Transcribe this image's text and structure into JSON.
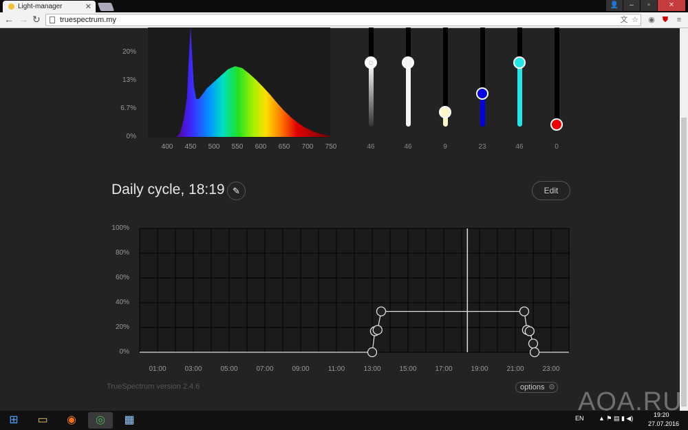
{
  "browser": {
    "tab_title": "Light-manager",
    "url": "truespectrum.my"
  },
  "spectrum": {
    "y_ticks": [
      "0%",
      "6.7%",
      "13%",
      "20%"
    ],
    "x_ticks": [
      "400",
      "450",
      "500",
      "550",
      "600",
      "650",
      "700",
      "750"
    ],
    "points": [
      [
        420,
        0
      ],
      [
        428,
        1
      ],
      [
        435,
        4
      ],
      [
        442,
        9
      ],
      [
        446,
        18
      ],
      [
        450,
        26
      ],
      [
        453,
        20
      ],
      [
        457,
        12
      ],
      [
        462,
        9
      ],
      [
        468,
        9
      ],
      [
        475,
        10
      ],
      [
        485,
        11.5
      ],
      [
        500,
        13
      ],
      [
        515,
        14.5
      ],
      [
        530,
        16
      ],
      [
        545,
        16.7
      ],
      [
        560,
        16.3
      ],
      [
        575,
        15
      ],
      [
        590,
        13.5
      ],
      [
        605,
        11.8
      ],
      [
        620,
        10
      ],
      [
        635,
        8
      ],
      [
        650,
        6.2
      ],
      [
        665,
        4.6
      ],
      [
        680,
        3.3
      ],
      [
        695,
        2.2
      ],
      [
        710,
        1.4
      ],
      [
        725,
        0.8
      ],
      [
        740,
        0.4
      ],
      [
        750,
        0.2
      ]
    ]
  },
  "sliders": [
    {
      "name": "master",
      "value": 46,
      "color": "#ffffff",
      "icon": "sun-icon"
    },
    {
      "name": "white",
      "value": 46,
      "color": "#f4f4f8"
    },
    {
      "name": "warm",
      "value": 9,
      "color": "#fdf7c9"
    },
    {
      "name": "blue",
      "value": 23,
      "color": "#0000e0"
    },
    {
      "name": "cyan",
      "value": 46,
      "color": "#22e6e6"
    },
    {
      "name": "red",
      "value": 0,
      "color": "#ee0000"
    }
  ],
  "cycle": {
    "title": "Daily cycle, 18:19",
    "edit_label": "Edit",
    "current_time": 18.32
  },
  "chart_data": {
    "type": "line",
    "y_ticks": [
      "0%",
      "20%",
      "40%",
      "60%",
      "80%",
      "100%"
    ],
    "x_ticks": [
      "01:00",
      "03:00",
      "05:00",
      "07:00",
      "09:00",
      "11:00",
      "13:00",
      "15:00",
      "17:00",
      "19:00",
      "21:00",
      "23:00"
    ],
    "xlim": [
      0,
      24
    ],
    "ylim": [
      0,
      100
    ],
    "grid": true,
    "points": [
      [
        13.0,
        0
      ],
      [
        13.15,
        17
      ],
      [
        13.3,
        18
      ],
      [
        13.5,
        33
      ],
      [
        21.5,
        33
      ],
      [
        21.65,
        18
      ],
      [
        21.8,
        17
      ],
      [
        22.0,
        7
      ],
      [
        22.08,
        0
      ]
    ]
  },
  "footer": {
    "version": "TrueSpectrum version 2.4.6",
    "options_label": "options"
  },
  "watermark": "AQA.RU",
  "taskbar": {
    "lang": "EN",
    "time": "19:20",
    "date": "27.07.2016"
  }
}
